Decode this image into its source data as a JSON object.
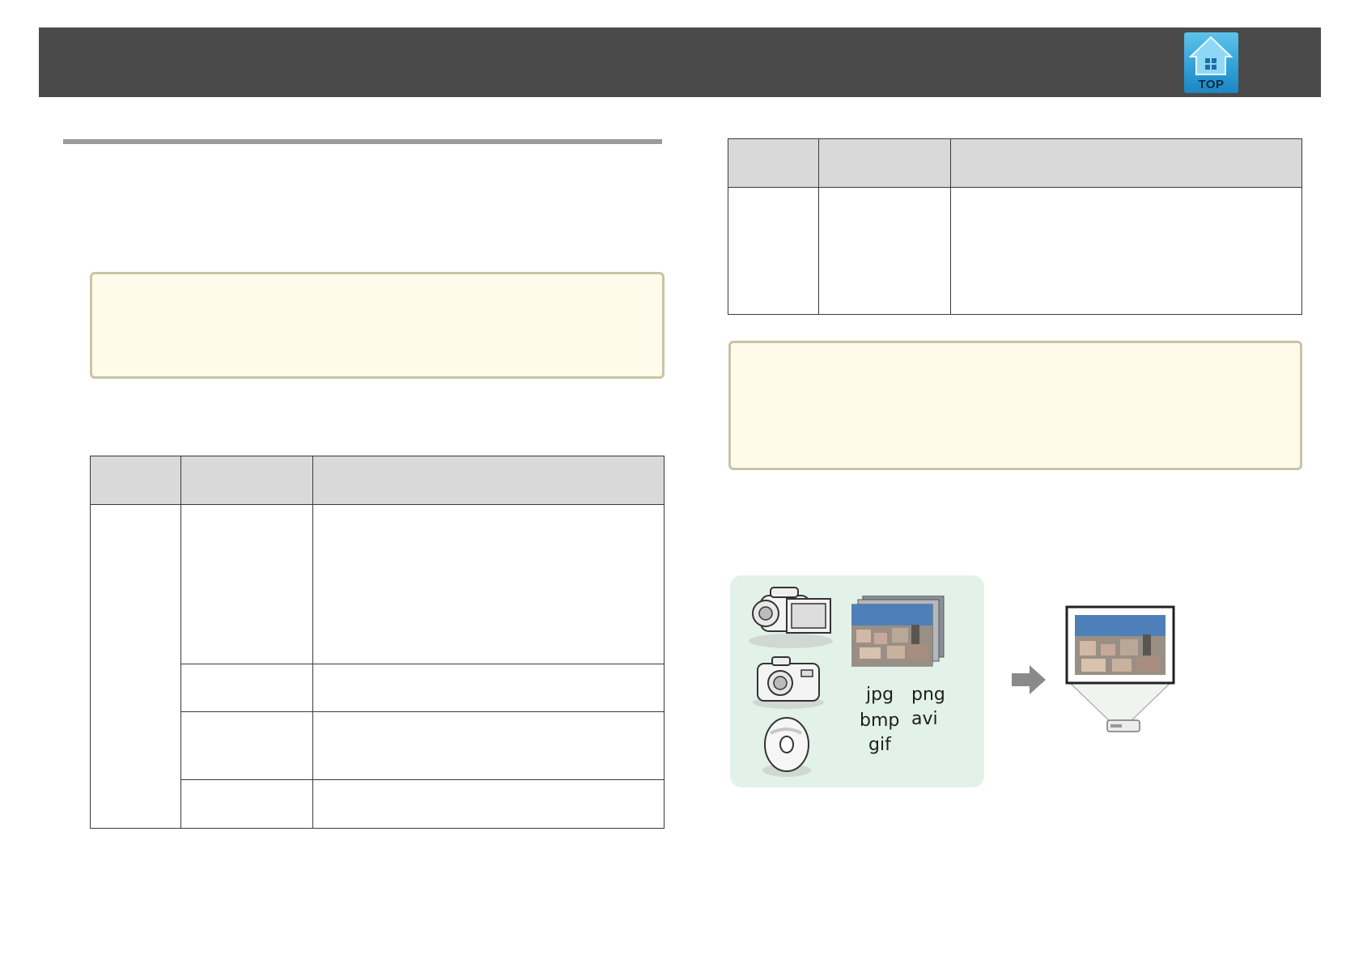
{
  "header": {
    "top_button_label": "TOP"
  },
  "illustration": {
    "formats": [
      "jpg",
      "png",
      "bmp",
      "avi",
      "gif"
    ]
  },
  "colors": {
    "header_bg": "#4a4a4a",
    "note_bg": "#fffbea",
    "note_border": "#c9c4a6",
    "table_header_bg": "#d9d9d9",
    "media_panel_bg": "#e3f2e8",
    "top_button": "#2f9fd6"
  }
}
